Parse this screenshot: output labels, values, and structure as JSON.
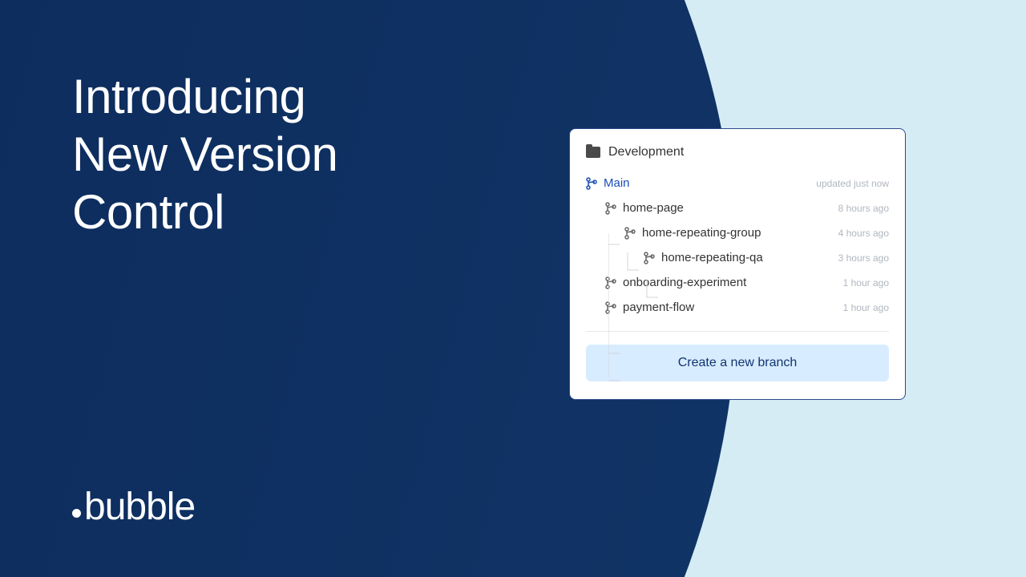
{
  "headline": {
    "line1": "Introducing",
    "line2": "New Version",
    "line3": "Control"
  },
  "logo": "bubble",
  "panel": {
    "section_title": "Development",
    "branches": [
      {
        "name": "Main",
        "time": "updated just now",
        "indent": 0,
        "active": true
      },
      {
        "name": "home-page",
        "time": "8 hours ago",
        "indent": 1,
        "active": false
      },
      {
        "name": "home-repeating-group",
        "time": "4 hours ago",
        "indent": 2,
        "active": false
      },
      {
        "name": "home-repeating-qa",
        "time": "3 hours ago",
        "indent": 3,
        "active": false
      },
      {
        "name": "onboarding-experiment",
        "time": "1 hour ago",
        "indent": 1,
        "active": false
      },
      {
        "name": "payment-flow",
        "time": "1 hour ago",
        "indent": 1,
        "active": false
      }
    ],
    "create_label": "Create a new branch"
  },
  "colors": {
    "dark_bg": "#113570",
    "light_bg": "#d6ecf5",
    "accent": "#1a4db3",
    "button_bg": "#d8ecff"
  }
}
